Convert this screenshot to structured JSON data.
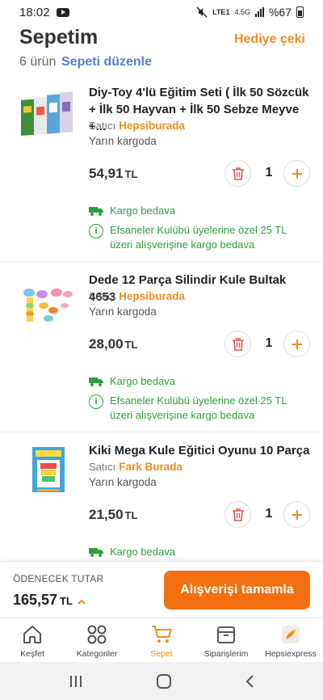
{
  "status": {
    "time": "18:02",
    "network": "LTE1",
    "speed": "4.5G",
    "battery": "%67"
  },
  "header": {
    "title": "Sepetim",
    "gift_label": "Hediye çeki",
    "count_label": "6 ürün",
    "edit_label": "Sepeti düzenle"
  },
  "items": [
    {
      "name": "Diy-Toy 4'lü Eğitim Seti ( İlk 50 Sözcük + İlk 50 Hayvan + İlk 50 Sebze Meyve +...",
      "seller_prefix": "Satıcı",
      "seller": "Hepsiburada",
      "delivery": "Yarın kargoda",
      "price": "54,91",
      "currency": "TL",
      "quantity": "1",
      "free_shipping": "Kargo bedava",
      "promo": "Efsaneler Kulübü üyelerine özel 25 TL üzeri alışverişine kargo bedava"
    },
    {
      "name": "Dede 12 Parça Silindir Kule Bultak 4653",
      "seller_prefix": "Satıcı",
      "seller": "Hepsiburada",
      "delivery": "Yarın kargoda",
      "price": "28,00",
      "currency": "TL",
      "quantity": "1",
      "free_shipping": "Kargo bedava",
      "promo": "Efsaneler Kulübü üyelerine özel 25 TL üzeri alışverişine kargo bedava"
    },
    {
      "name": "Kiki Mega Kule Eğitici Oyunu 10 Parça",
      "seller_prefix": "Satıcı",
      "seller": "Fark Burada",
      "delivery": "Yarın kargoda",
      "price": "21,50",
      "currency": "TL",
      "quantity": "1",
      "free_shipping": "Kargo bedava"
    }
  ],
  "summary": {
    "label": "ÖDENECEK TUTAR",
    "total": "165,57",
    "currency": "TL",
    "checkout_label": "Alışverişi tamamla"
  },
  "tabs": [
    {
      "label": "Keşfet",
      "icon": "home-icon"
    },
    {
      "label": "Kategoriler",
      "icon": "grid-icon"
    },
    {
      "label": "Sepet",
      "icon": "cart-icon"
    },
    {
      "label": "Siparişlerim",
      "icon": "box-icon"
    },
    {
      "label": "Hepsiexpress",
      "icon": "express-icon"
    }
  ],
  "colors": {
    "accent": "#f28b1d",
    "button": "#f36f0f",
    "link": "#5b7cd9",
    "success": "#2e9f3d"
  }
}
